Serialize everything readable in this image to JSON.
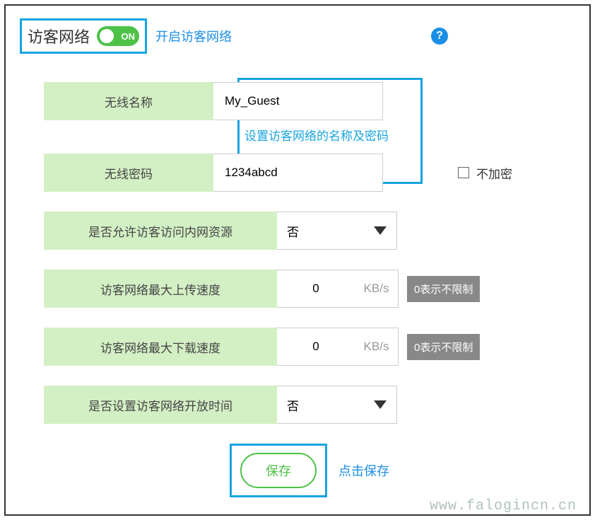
{
  "header": {
    "title": "访客网络",
    "toggle_state": "ON",
    "toggle_hint": "开启访客网络",
    "help_icon": "?"
  },
  "fields": {
    "ssid": {
      "label": "无线名称",
      "value": "My_Guest"
    },
    "name_pwd_hint": "设置访客网络的名称及密码",
    "password": {
      "label": "无线密码",
      "value": "1234abcd"
    },
    "no_encrypt_label": "不加密",
    "allow_intranet": {
      "label": "是否允许访客访问内网资源",
      "value": "否"
    },
    "max_upload": {
      "label": "访客网络最大上传速度",
      "value": "0",
      "unit": "KB/s",
      "hint": "0表示不限制"
    },
    "max_download": {
      "label": "访客网络最大下载速度",
      "value": "0",
      "unit": "KB/s",
      "hint": "0表示不限制"
    },
    "schedule": {
      "label": "是否设置访客网络开放时间",
      "value": "否"
    }
  },
  "footer": {
    "save_label": "保存",
    "save_hint": "点击保存"
  },
  "watermark": "www.falogincn.cn"
}
